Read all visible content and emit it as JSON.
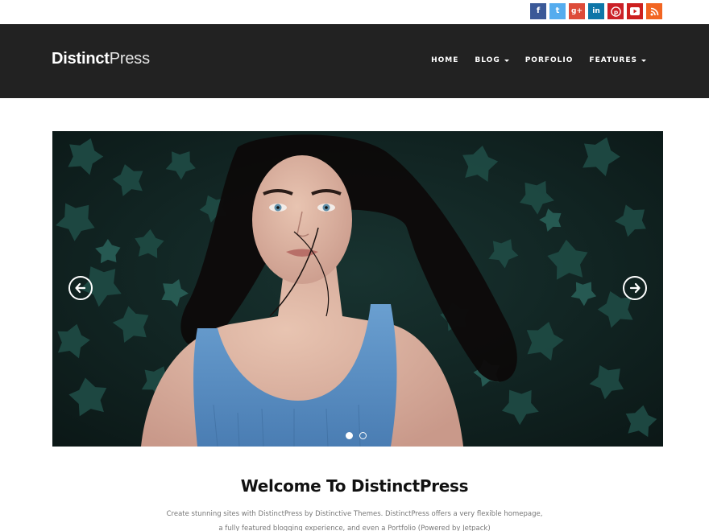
{
  "social": [
    {
      "name": "facebook",
      "glyph": "f",
      "color": "#3b5998"
    },
    {
      "name": "twitter",
      "glyph": "t",
      "color": "#55acee"
    },
    {
      "name": "google-plus",
      "glyph": "g+",
      "color": "#dd4b39"
    },
    {
      "name": "linkedin",
      "glyph": "in",
      "color": "#0e76a8"
    },
    {
      "name": "pinterest",
      "glyph": "p",
      "color": "#cb2027"
    },
    {
      "name": "youtube",
      "glyph": "▶",
      "color": "#cd201f"
    },
    {
      "name": "rss",
      "glyph": "rss",
      "color": "#f26522"
    }
  ],
  "header": {
    "logo_bold": "Distinct",
    "logo_light": "Press",
    "nav": [
      {
        "label": "HOME",
        "dropdown": false
      },
      {
        "label": "BLOG",
        "dropdown": true
      },
      {
        "label": "PORFOLIO",
        "dropdown": false
      },
      {
        "label": "FEATURES",
        "dropdown": true
      }
    ]
  },
  "slider": {
    "slides": 2,
    "active_index": 0
  },
  "welcome": {
    "title": "Welcome To DistinctPress",
    "text_line1": "Create stunning sites with DistinctPress by Distinctive Themes. DistinctPress offers a very flexible homepage,",
    "text_line2": "a fully featured blogging experience, and even a Portfolio (Powered by Jetpack)"
  },
  "colors": {
    "header_bg": "#222222",
    "foliage": "#1f4a44",
    "dress": "#5a8fc2"
  }
}
